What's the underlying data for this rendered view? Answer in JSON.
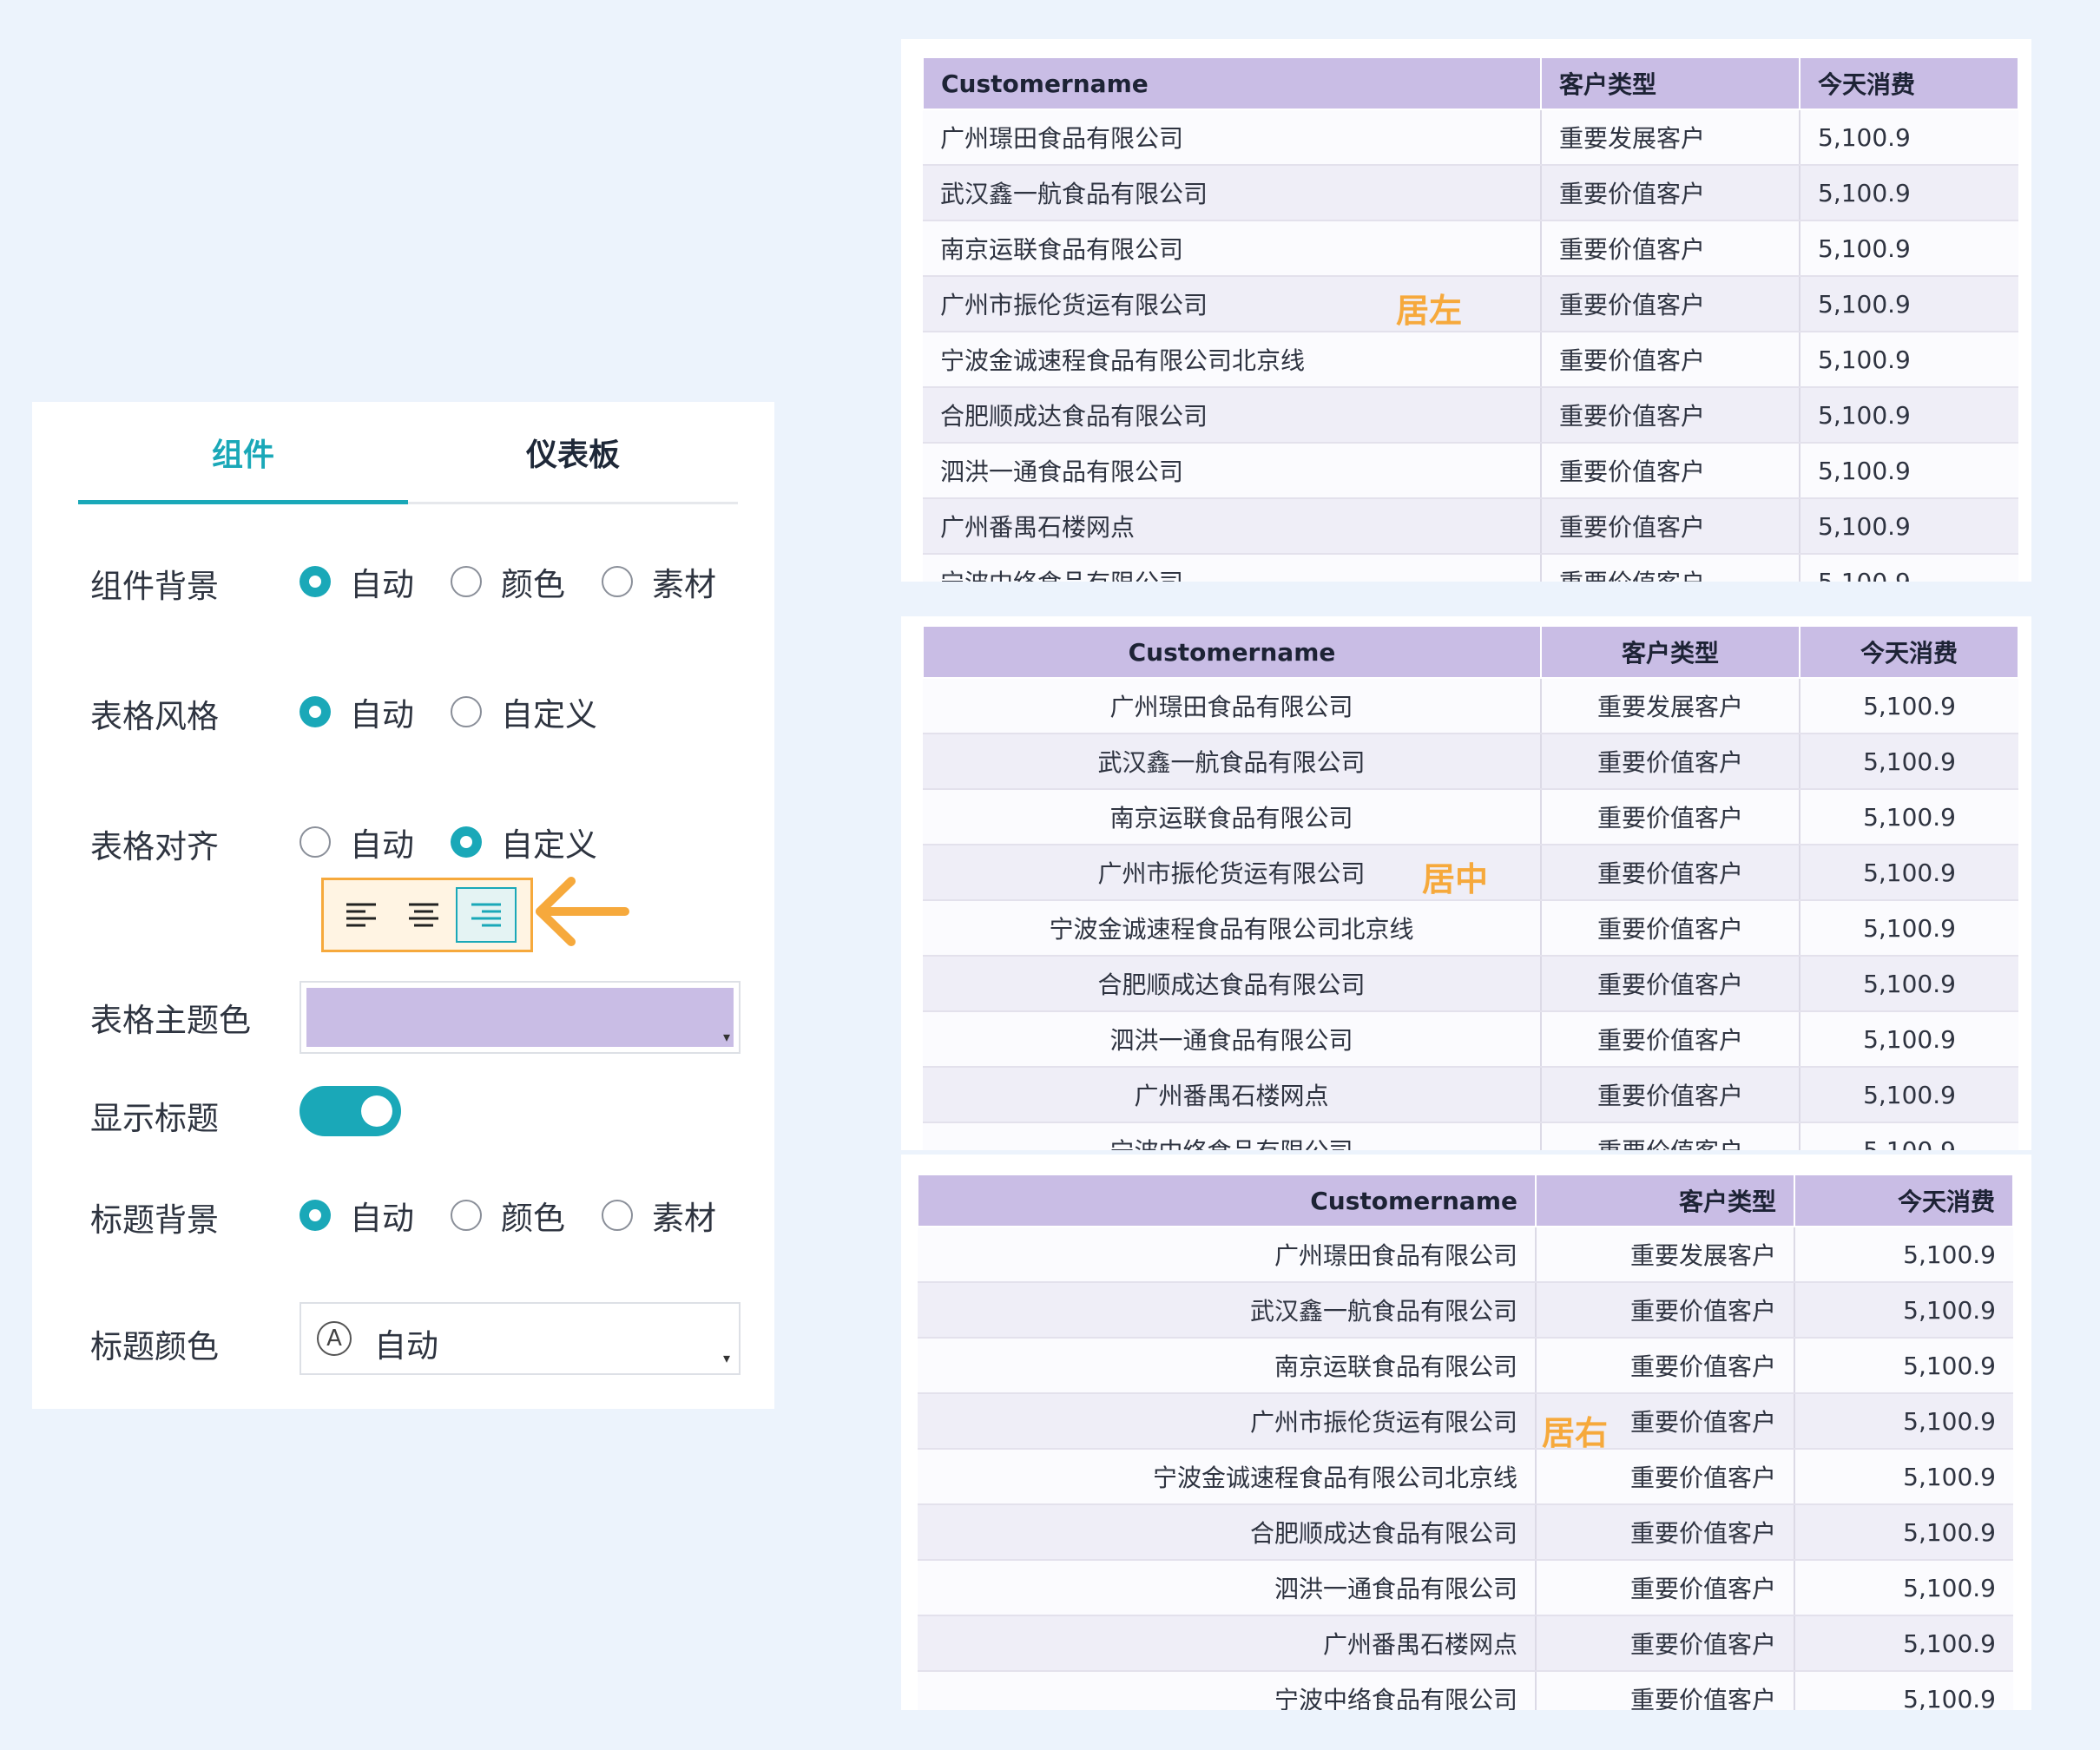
{
  "panel": {
    "tabs": [
      {
        "label": "组件",
        "active": true
      },
      {
        "label": "仪表板",
        "active": false
      }
    ],
    "component_bg": {
      "label": "组件背景",
      "options": [
        "自动",
        "颜色",
        "素材"
      ],
      "selected": "自动"
    },
    "table_style": {
      "label": "表格风格",
      "options": [
        "自动",
        "自定义"
      ],
      "selected": "自动"
    },
    "table_align": {
      "label": "表格对齐",
      "options": [
        "自动",
        "自定义"
      ],
      "selected": "自定义",
      "align_buttons": [
        "align-left-icon",
        "align-center-icon",
        "align-right-icon"
      ],
      "selected_align": "right"
    },
    "theme_color": {
      "label": "表格主题色",
      "value_color": "#c9bde5"
    },
    "show_title": {
      "label": "显示标题",
      "on": true
    },
    "title_bg": {
      "label": "标题背景",
      "options": [
        "自动",
        "颜色",
        "素材"
      ],
      "selected": "自动"
    },
    "title_color": {
      "label": "标题颜色",
      "value": "自动",
      "icon": "font-color-icon"
    }
  },
  "accent_color": "#1aa8b8",
  "highlight_color": "#f6a93c",
  "table": {
    "headers": [
      "Customername",
      "客户类型",
      "今天消费"
    ],
    "rows": [
      [
        "广州璟田食品有限公司",
        "重要发展客户",
        "5,100.9"
      ],
      [
        "武汉鑫一航食品有限公司",
        "重要价值客户",
        "5,100.9"
      ],
      [
        "南京运联食品有限公司",
        "重要价值客户",
        "5,100.9"
      ],
      [
        "广州市振伦货运有限公司",
        "重要价值客户",
        "5,100.9"
      ],
      [
        "宁波金诚速程食品有限公司北京线",
        "重要价值客户",
        "5,100.9"
      ],
      [
        "合肥顺成达食品有限公司",
        "重要价值客户",
        "5,100.9"
      ],
      [
        "泗洪一通食品有限公司",
        "重要价值客户",
        "5,100.9"
      ],
      [
        "广州番禺石楼网点",
        "重要价值客户",
        "5,100.9"
      ],
      [
        "宁波中络食品有限公司",
        "重要价值客户",
        "5,100.9"
      ]
    ]
  },
  "callouts": {
    "left": "居左",
    "center": "居中",
    "right": "居右"
  }
}
